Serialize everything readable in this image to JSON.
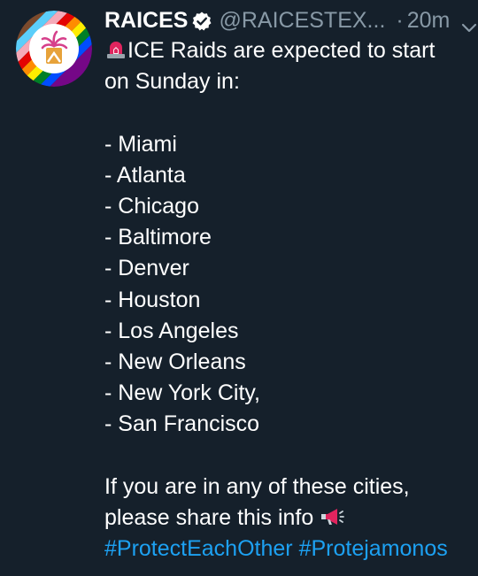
{
  "author": {
    "display_name": "RAICES",
    "handle": "@RAICESTEX...",
    "separator": "·",
    "time": "20m",
    "verified_icon": "verified-badge-icon",
    "avatar_icon": "raices-logo-icon"
  },
  "tweet": {
    "intro_line_1": "ICE Raids are expected to start",
    "intro_line_2": "on Sunday in:",
    "cities": [
      "- Miami",
      "- Atlanta",
      "- Chicago",
      "- Baltimore",
      "- Denver",
      "- Houston",
      "- Los Angeles",
      "- New Orleans",
      "- New York City,",
      "- San Francisco"
    ],
    "closing_line_1": "If you are in any of these cities,",
    "closing_line_2": "please share this info",
    "hashtags": [
      "#ProtectEachOther",
      "#Protejamonos"
    ],
    "siren_emoji": "rotating-light-icon",
    "megaphone_emoji": "loudspeaker-icon"
  },
  "colors": {
    "background": "#15202b",
    "text": "#ffffff",
    "secondary": "#8899a6",
    "link": "#1da1f2"
  }
}
